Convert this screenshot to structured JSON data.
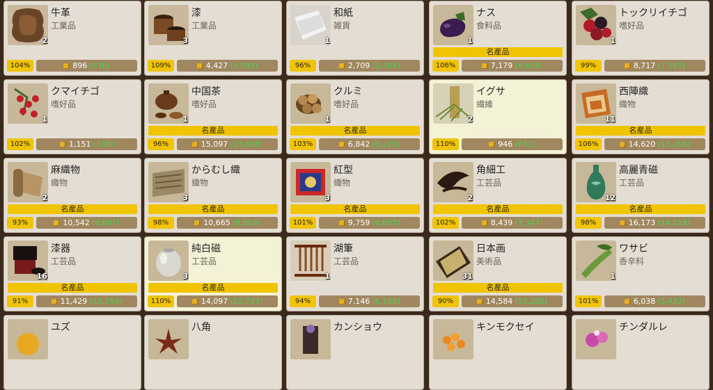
{
  "items": [
    {
      "name": "牛革",
      "category": "工業品",
      "qty": "2",
      "specialty": "",
      "percent": "104%",
      "price": "896",
      "original": "(530)",
      "icon": "leather-hide-icon",
      "highlight": false
    },
    {
      "name": "漆",
      "category": "工業品",
      "qty": "3",
      "specialty": "",
      "percent": "109%",
      "price": "4,427",
      "original": "(3,981)",
      "icon": "lacquer-bucket-icon",
      "highlight": false
    },
    {
      "name": "和紙",
      "category": "雑貨",
      "qty": "1",
      "specialty": "",
      "percent": "96%",
      "price": "2,709",
      "original": "(2,401)",
      "icon": "washi-paper-icon",
      "highlight": false
    },
    {
      "name": "ナス",
      "category": "食料品",
      "qty": "1",
      "specialty": "名産品",
      "percent": "106%",
      "price": "7,179",
      "original": "(6,669)",
      "icon": "eggplant-icon",
      "highlight": false
    },
    {
      "name": "トックリイチゴ",
      "category": "嗜好品",
      "qty": "1",
      "specialty": "",
      "percent": "99%",
      "price": "8,717",
      "original": "(7,787)",
      "icon": "raspberry-icon",
      "highlight": false
    },
    {
      "name": "クマイチゴ",
      "category": "嗜好品",
      "qty": "1",
      "specialty": "",
      "percent": "102%",
      "price": "1,151",
      "original": "(728)",
      "icon": "red-berries-icon",
      "highlight": false
    },
    {
      "name": "中国茶",
      "category": "嗜好品",
      "qty": "1",
      "specialty": "名産品",
      "percent": "96%",
      "price": "15,097",
      "original": "(13,698)",
      "icon": "teapot-icon",
      "highlight": false
    },
    {
      "name": "クルミ",
      "category": "嗜好品",
      "qty": "1",
      "specialty": "名産品",
      "percent": "103%",
      "price": "6,842",
      "original": "(6,226)",
      "icon": "walnut-icon",
      "highlight": false
    },
    {
      "name": "イグサ",
      "category": "繊維",
      "qty": "2",
      "specialty": "",
      "percent": "110%",
      "price": "946",
      "original": "(632)",
      "icon": "rush-grass-icon",
      "highlight": true
    },
    {
      "name": "西陣織",
      "category": "織物",
      "qty": "11",
      "specialty": "名産品",
      "percent": "106%",
      "price": "14,620",
      "original": "(13,266)",
      "icon": "nishijin-textile-icon",
      "highlight": false
    },
    {
      "name": "麻織物",
      "category": "織物",
      "qty": "2",
      "specialty": "名産品",
      "percent": "93%",
      "price": "10,542",
      "original": "(9,697)",
      "icon": "hemp-cloth-icon",
      "highlight": false
    },
    {
      "name": "からむし織",
      "category": "織物",
      "qty": "3",
      "specialty": "名産品",
      "percent": "98%",
      "price": "10,665",
      "original": "(9,619)",
      "icon": "ramie-cloth-icon",
      "highlight": false
    },
    {
      "name": "紅型",
      "category": "織物",
      "qty": "3",
      "specialty": "名産品",
      "percent": "101%",
      "price": "9,759",
      "original": "(8,667)",
      "icon": "bingata-fabric-icon",
      "highlight": false
    },
    {
      "name": "角細工",
      "category": "工芸品",
      "qty": "2",
      "specialty": "名産品",
      "percent": "102%",
      "price": "8,439",
      "original": "(7,347)",
      "icon": "horn-craft-icon",
      "highlight": false
    },
    {
      "name": "高麗青磁",
      "category": "工芸品",
      "qty": "12",
      "specialty": "名産品",
      "percent": "98%",
      "price": "16,173",
      "original": "(14,218)",
      "icon": "celadon-vase-icon",
      "highlight": false
    },
    {
      "name": "漆器",
      "category": "工芸品",
      "qty": "16",
      "specialty": "名産品",
      "percent": "91%",
      "price": "11,429",
      "original": "(10,250)",
      "icon": "lacquerware-box-icon",
      "highlight": false
    },
    {
      "name": "純白磁",
      "category": "工芸品",
      "qty": "3",
      "specialty": "名産品",
      "percent": "110%",
      "price": "14,097",
      "original": "(12,723)",
      "icon": "white-porcelain-jar-icon",
      "highlight": true
    },
    {
      "name": "湖筆",
      "category": "工芸品",
      "qty": "1",
      "specialty": "",
      "percent": "94%",
      "price": "7,146",
      "original": "(6,138)",
      "icon": "brush-rack-icon",
      "highlight": false
    },
    {
      "name": "日本画",
      "category": "美術品",
      "qty": "31",
      "specialty": "名産品",
      "percent": "90%",
      "price": "14,584",
      "original": "(13,202)",
      "icon": "scroll-painting-icon",
      "highlight": false
    },
    {
      "name": "ワサビ",
      "category": "香辛料",
      "qty": "1",
      "specialty": "",
      "percent": "101%",
      "price": "6,038",
      "original": "(5,432)",
      "icon": "wasabi-icon",
      "highlight": false
    },
    {
      "name": "ユズ",
      "category": "",
      "qty": "",
      "specialty": "",
      "percent": "",
      "price": "",
      "original": "",
      "icon": "yuzu-icon",
      "highlight": false
    },
    {
      "name": "八角",
      "category": "",
      "qty": "",
      "specialty": "",
      "percent": "",
      "price": "",
      "original": "",
      "icon": "star-anise-icon",
      "highlight": false
    },
    {
      "name": "カンショウ",
      "category": "",
      "qty": "",
      "specialty": "",
      "percent": "",
      "price": "",
      "original": "",
      "icon": "kansho-herb-icon",
      "highlight": false
    },
    {
      "name": "キンモクセイ",
      "category": "",
      "qty": "",
      "specialty": "",
      "percent": "",
      "price": "",
      "original": "",
      "icon": "osmanthus-icon",
      "highlight": false
    },
    {
      "name": "チンダルレ",
      "category": "",
      "qty": "",
      "specialty": "",
      "percent": "",
      "price": "",
      "original": "",
      "icon": "azalea-icon",
      "highlight": false
    }
  ],
  "colors": {
    "card_bg": "#e4ddd3",
    "card_highlight_bg": "#f3f2d6",
    "specialty_bar": "#f0c400",
    "price_bar": "#a08760",
    "original_price_text": "#4fd14a",
    "background": "#3a2a1c"
  }
}
